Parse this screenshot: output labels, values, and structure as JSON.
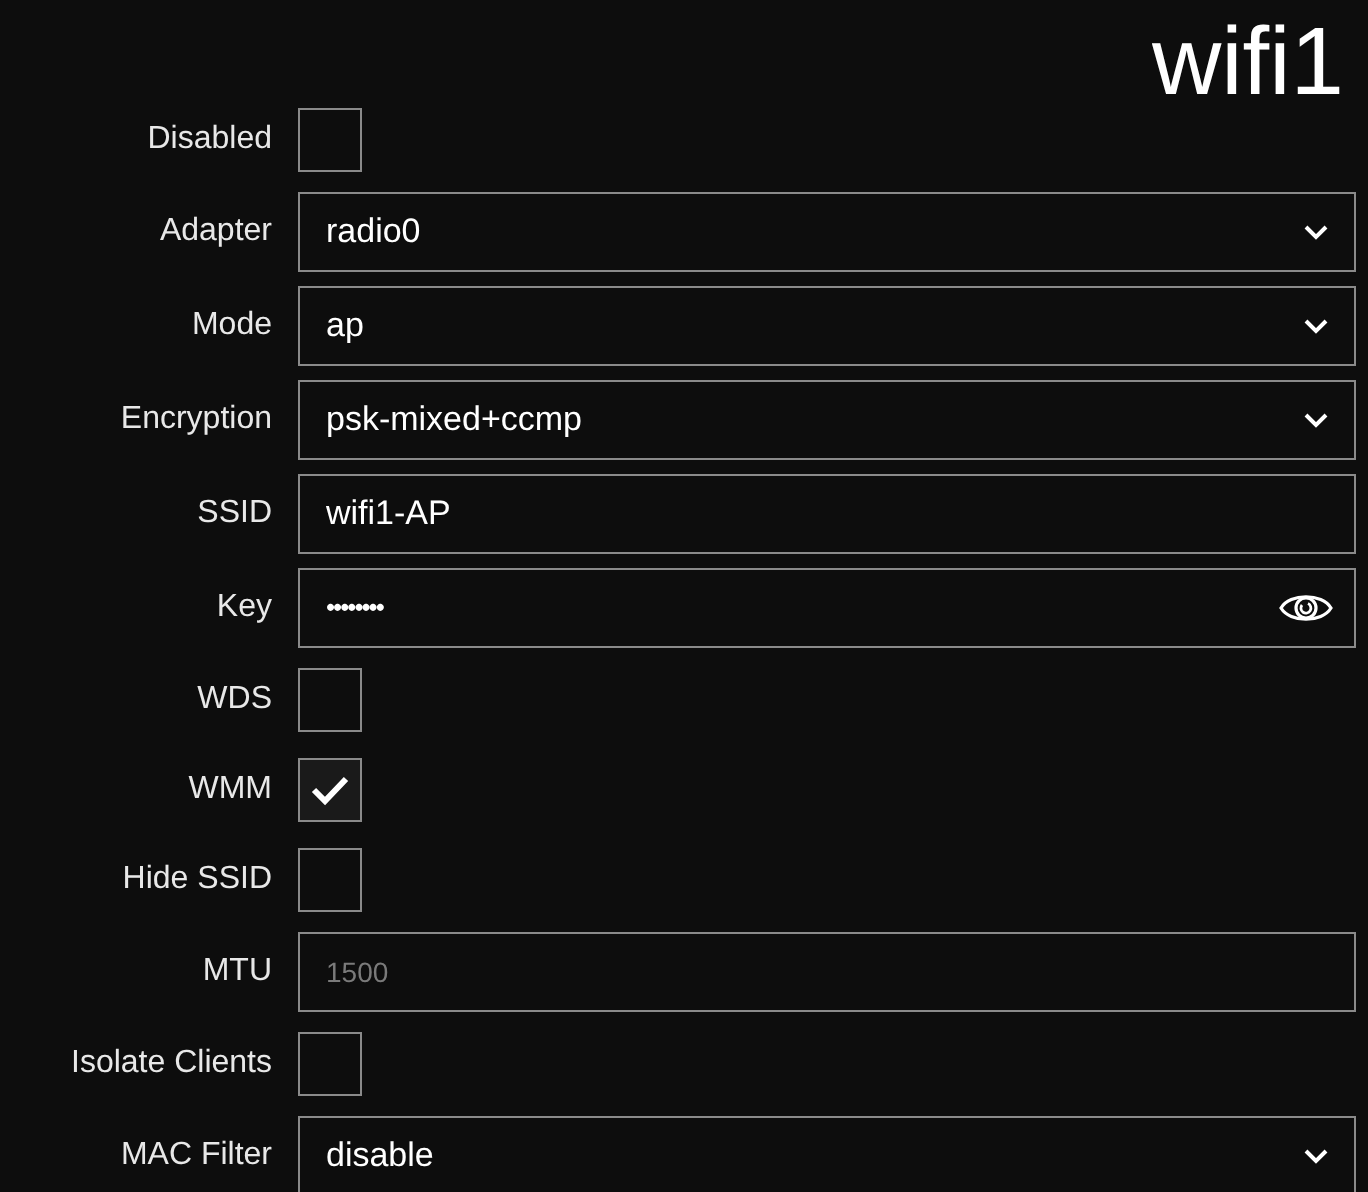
{
  "title": "wifi1",
  "fields": [
    {
      "kind": "checkbox",
      "label": "Disabled",
      "checked": false
    },
    {
      "kind": "select",
      "label": "Adapter",
      "value": "radio0"
    },
    {
      "kind": "select",
      "label": "Mode",
      "value": "ap"
    },
    {
      "kind": "select",
      "label": "Encryption",
      "value": "psk-mixed+ccmp"
    },
    {
      "kind": "text",
      "label": "SSID",
      "value": "wifi1-AP"
    },
    {
      "kind": "password",
      "label": "Key",
      "value": "••••••••"
    },
    {
      "kind": "checkbox",
      "label": "WDS",
      "checked": false
    },
    {
      "kind": "checkbox",
      "label": "WMM",
      "checked": true
    },
    {
      "kind": "checkbox",
      "label": "Hide SSID",
      "checked": false
    },
    {
      "kind": "text",
      "label": "MTU",
      "placeholder": "1500"
    },
    {
      "kind": "checkbox",
      "label": "Isolate Clients",
      "checked": false
    },
    {
      "kind": "select",
      "label": "MAC Filter",
      "value": "disable"
    }
  ]
}
